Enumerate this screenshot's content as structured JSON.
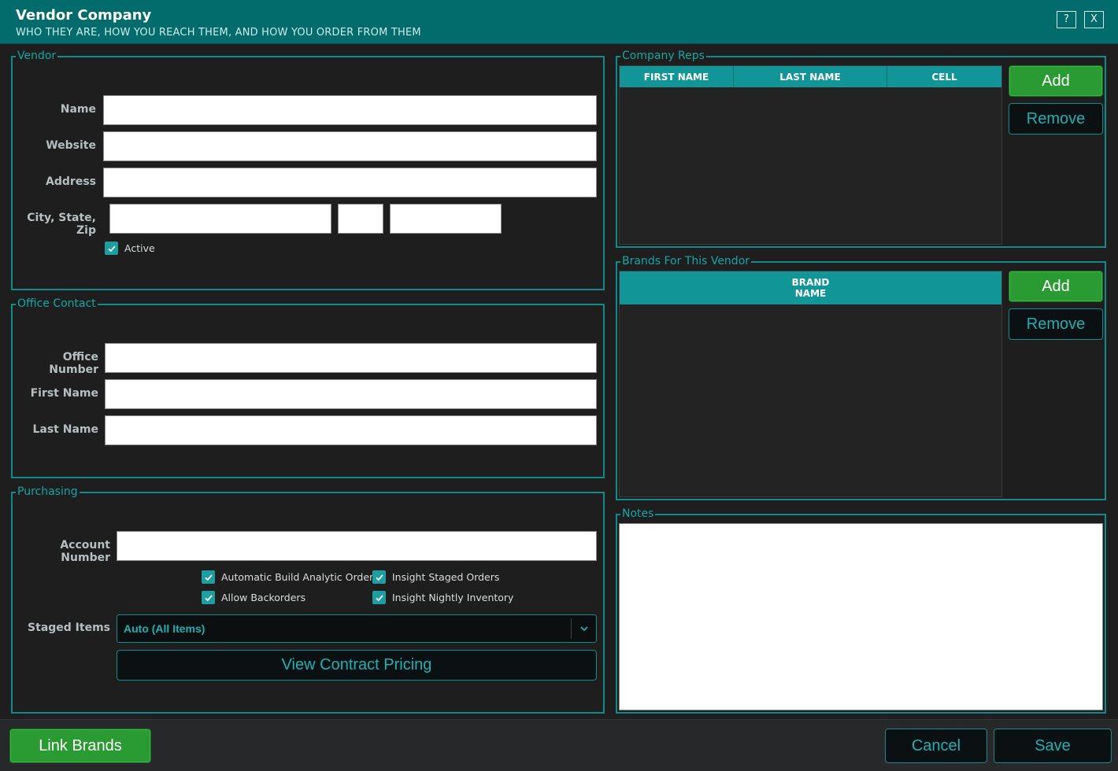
{
  "window": {
    "title": "Vendor Company",
    "subtitle": "WHO THEY ARE, HOW YOU REACH THEM, AND HOW YOU ORDER FROM THEM",
    "help_label": "?",
    "close_label": "X"
  },
  "vendor": {
    "title": "Vendor",
    "name_label": "Name",
    "name_value": "",
    "website_label": "Website",
    "website_value": "",
    "address_label": "Address",
    "address_value": "",
    "csz_label": "City, State, Zip",
    "city_value": "",
    "state_value": "",
    "zip_value": "",
    "active_label": "Active",
    "active_checked": true
  },
  "office_contact": {
    "title": "Office Contact",
    "office_number_label": "Office Number",
    "office_number_value": "",
    "first_name_label": "First Name",
    "first_name_value": "",
    "last_name_label": "Last Name",
    "last_name_value": ""
  },
  "purchasing": {
    "title": "Purchasing",
    "account_number_label": "Account Number",
    "account_number_value": "",
    "checkboxes": [
      {
        "label": "Automatic Build Analytic Orders",
        "checked": true
      },
      {
        "label": "Insight Staged Orders",
        "checked": true
      },
      {
        "label": "Allow Backorders",
        "checked": true
      },
      {
        "label": "Insight Nightly Inventory",
        "checked": true
      }
    ],
    "staged_items_label": "Staged Items",
    "staged_items_value": "Auto (All Items)",
    "view_contract_label": "View Contract Pricing"
  },
  "company_reps": {
    "title": "Company Reps",
    "columns": [
      "FIRST NAME",
      "LAST NAME",
      "CELL"
    ],
    "rows": [],
    "add_label": "Add",
    "remove_label": "Remove"
  },
  "brands": {
    "title": "Brands For This Vendor",
    "column_line1": "BRAND",
    "column_line2": "NAME",
    "rows": [],
    "add_label": "Add",
    "remove_label": "Remove"
  },
  "notes": {
    "title": "Notes",
    "value": ""
  },
  "footer": {
    "link_brands_label": "Link Brands",
    "cancel_label": "Cancel",
    "save_label": "Save"
  },
  "colors": {
    "title_bar": "#026c6c",
    "accent": "#16a5a5",
    "green_button": "#2a9b33",
    "background": "#1e1e1e"
  }
}
